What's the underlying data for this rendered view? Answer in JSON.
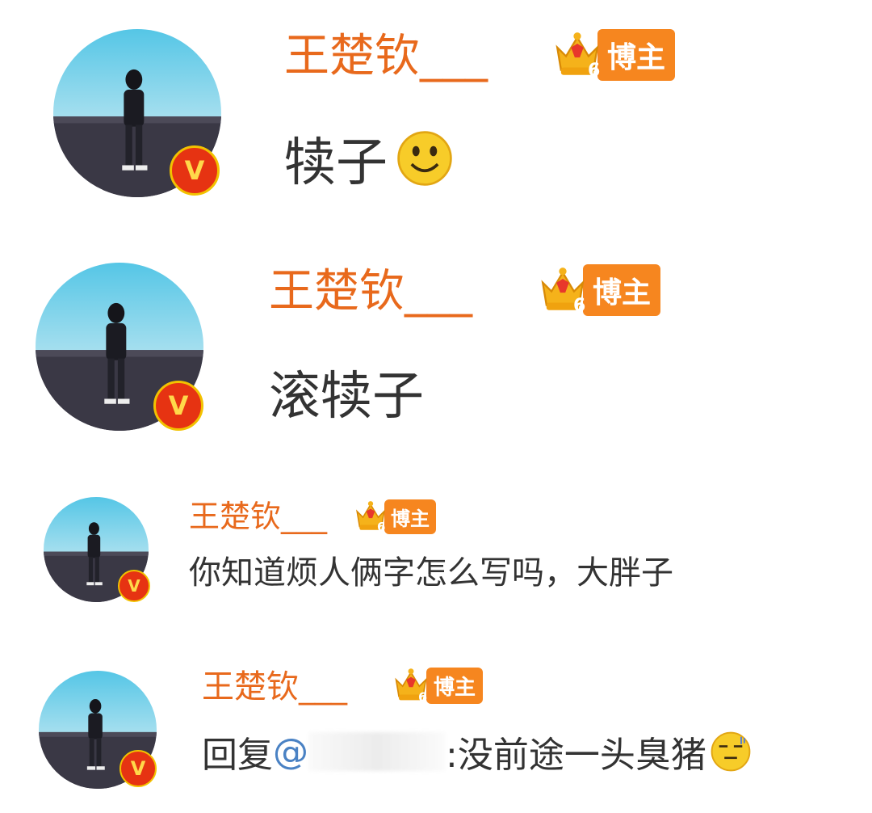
{
  "comments": [
    {
      "username": "王楚钦___",
      "level": "6",
      "role_badge": "博主",
      "text": "犊子",
      "emoji": "smile-emoji"
    },
    {
      "username": "王楚钦___",
      "level": "6",
      "role_badge": "博主",
      "text": "滚犊子"
    },
    {
      "username": "王楚钦___",
      "level": "6",
      "role_badge": "博主",
      "text": "你知道烦人俩字怎么写吗，大胖子"
    },
    {
      "username": "王楚钦___",
      "level": "6",
      "role_badge": "博主",
      "reply_prefix": "回复",
      "mention": "@",
      "text": ":没前途一头臭猪",
      "emoji": "speechless-emoji"
    }
  ],
  "verified_mark": "V",
  "colors": {
    "username": "#e8691c",
    "badge": "#f6861f",
    "mention": "#4a82c4",
    "verified": "#e63312"
  }
}
